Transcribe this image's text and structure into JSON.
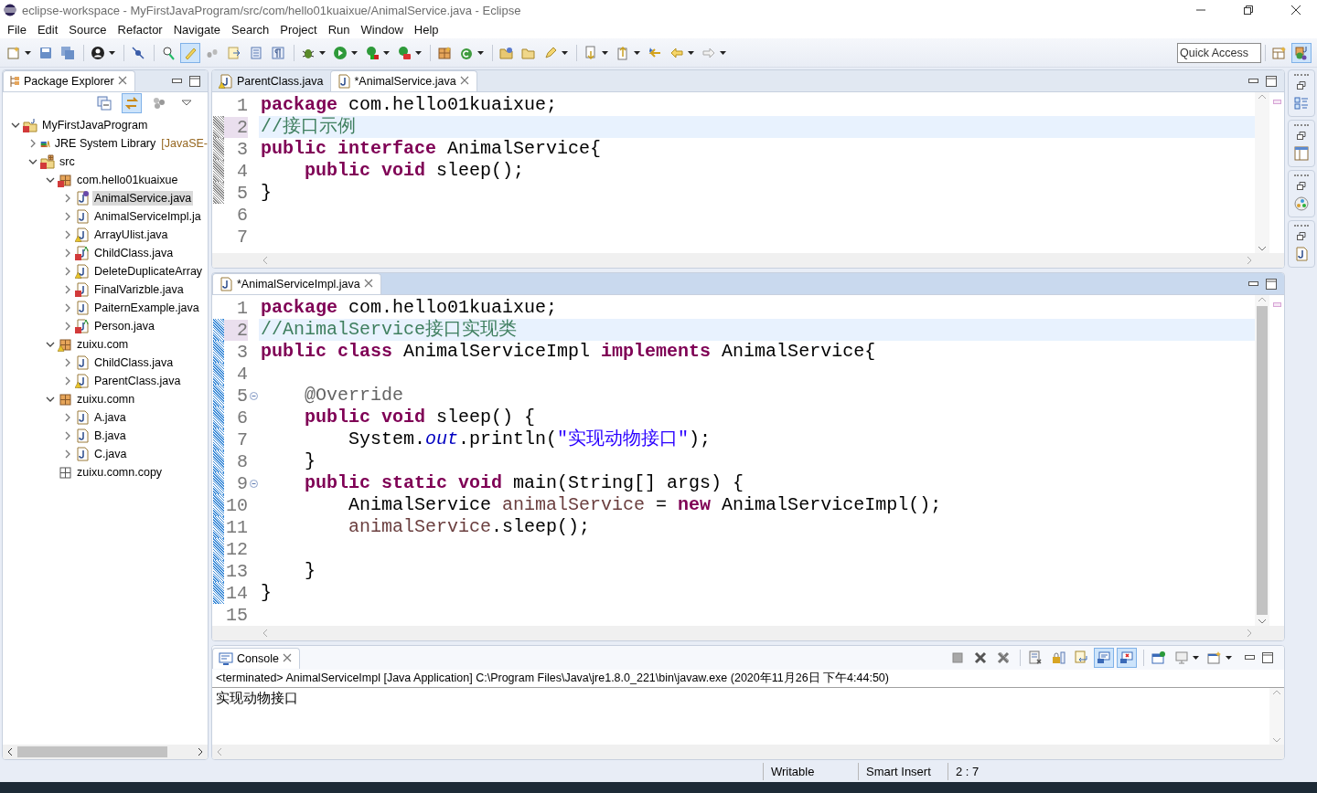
{
  "window": {
    "title": "eclipse-workspace - MyFirstJavaProgram/src/com/hello01kuaixue/AnimalService.java - Eclipse"
  },
  "menu": [
    "File",
    "Edit",
    "Source",
    "Refactor",
    "Navigate",
    "Search",
    "Project",
    "Run",
    "Window",
    "Help"
  ],
  "toolbar": [
    {
      "pressed": false
    },
    {
      "pressed": false
    },
    {
      "pressed": false
    },
    {
      "pressed": false
    },
    {
      "pressed": false
    },
    {
      "pressed": false
    },
    {
      "pressed": true
    },
    {
      "pressed": false
    },
    {
      "pressed": false
    },
    {
      "pressed": false
    },
    {
      "pressed": false
    },
    {
      "pressed": false
    },
    {
      "pressed": false
    },
    {
      "pressed": false
    },
    {
      "pressed": false
    },
    {
      "pressed": false
    },
    {
      "pressed": false
    },
    {
      "pressed": false
    },
    {
      "pressed": false
    },
    {
      "pressed": false
    },
    {
      "pressed": false
    },
    {
      "pressed": false
    },
    {
      "pressed": false
    },
    {
      "pressed": false
    },
    {
      "pressed": false
    }
  ],
  "quick_access": {
    "placeholder": "Quick Access"
  },
  "perspectives": [
    {
      "selected": false
    },
    {
      "selected": true
    }
  ],
  "package_explorer": {
    "title": "Package Explorer",
    "link_with_editor": true,
    "tree": [
      {
        "label": "MyFirstJavaProgram",
        "kind": "project",
        "error": true,
        "warning": false,
        "expanded": true,
        "selected": false,
        "children": [
          {
            "label": "JRE System Library",
            "suffix": "[JavaSE-",
            "kind": "library",
            "error": false,
            "warning": false,
            "expanded": false,
            "selected": false
          },
          {
            "label": "src",
            "kind": "folder",
            "error": true,
            "warning": false,
            "expanded": true,
            "selected": false,
            "children": [
              {
                "label": "com.hello01kuaixue",
                "kind": "package",
                "error": true,
                "warning": false,
                "expanded": true,
                "selected": false,
                "children": [
                  {
                    "label": "AnimalService.java",
                    "kind": "interface",
                    "error": false,
                    "warning": false,
                    "expanded": false,
                    "selected": true
                  },
                  {
                    "label": "AnimalServiceImpl.ja",
                    "kind": "class",
                    "error": false,
                    "warning": false,
                    "expanded": false,
                    "selected": false
                  },
                  {
                    "label": "ArrayUlist.java",
                    "kind": "class",
                    "error": false,
                    "warning": true,
                    "expanded": false,
                    "selected": false
                  },
                  {
                    "label": "ChildClass.java",
                    "kind": "abstract",
                    "error": true,
                    "warning": false,
                    "expanded": false,
                    "selected": false
                  },
                  {
                    "label": "DeleteDuplicateArray",
                    "kind": "class",
                    "error": false,
                    "warning": true,
                    "expanded": false,
                    "selected": false
                  },
                  {
                    "label": "FinalVarizble.java",
                    "kind": "class",
                    "error": true,
                    "warning": false,
                    "expanded": false,
                    "selected": false
                  },
                  {
                    "label": "PaiternExample.java",
                    "kind": "class",
                    "error": false,
                    "warning": false,
                    "expanded": false,
                    "selected": false
                  },
                  {
                    "label": "Person.java",
                    "kind": "abstract",
                    "error": true,
                    "warning": false,
                    "expanded": false,
                    "selected": false
                  }
                ]
              },
              {
                "label": "zuixu.com",
                "kind": "package",
                "error": false,
                "warning": true,
                "expanded": true,
                "selected": false,
                "children": [
                  {
                    "label": "ChildClass.java",
                    "kind": "class",
                    "error": false,
                    "warning": false,
                    "expanded": false,
                    "selected": false
                  },
                  {
                    "label": "ParentClass.java",
                    "kind": "class",
                    "error": false,
                    "warning": true,
                    "expanded": false,
                    "selected": false
                  }
                ]
              },
              {
                "label": "zuixu.comn",
                "kind": "package",
                "error": false,
                "warning": false,
                "expanded": true,
                "selected": false,
                "children": [
                  {
                    "label": "A.java",
                    "kind": "class",
                    "error": false,
                    "warning": false,
                    "expanded": false,
                    "selected": false
                  },
                  {
                    "label": "B.java",
                    "kind": "class",
                    "error": false,
                    "warning": false,
                    "expanded": false,
                    "selected": false
                  },
                  {
                    "label": "C.java",
                    "kind": "class",
                    "error": false,
                    "warning": false,
                    "expanded": false,
                    "selected": false
                  }
                ]
              },
              {
                "label": "zuixu.comn.copy",
                "kind": "empty",
                "error": false,
                "warning": false,
                "selected": false
              }
            ]
          }
        ]
      }
    ]
  },
  "editors": [
    {
      "active": false,
      "tabs": [
        {
          "label": "ParentClass.java",
          "warning": true,
          "selected": false
        },
        {
          "label": "*AnimalService.java",
          "warning": false,
          "selected": true
        }
      ],
      "lines": [
        {
          "number": "1",
          "changed": false,
          "current": false,
          "fold": false,
          "tokens": [
            {
              "kind": "kw",
              "text": "package"
            },
            {
              "kind": "text",
              "text": " com.hello01kuaixue;"
            }
          ]
        },
        {
          "number": "2",
          "changed": true,
          "current": true,
          "fold": false,
          "tokens": [
            {
              "kind": "comment",
              "text": "//接口示例"
            }
          ]
        },
        {
          "number": "3",
          "changed": true,
          "current": false,
          "fold": false,
          "tokens": [
            {
              "kind": "kw",
              "text": "public interface"
            },
            {
              "kind": "text",
              "text": " AnimalService{"
            }
          ]
        },
        {
          "number": "4",
          "changed": true,
          "current": false,
          "fold": false,
          "tokens": [
            {
              "kind": "kw",
              "text": "    public void"
            },
            {
              "kind": "text",
              "text": " sleep();"
            }
          ]
        },
        {
          "number": "5",
          "changed": true,
          "current": false,
          "fold": false,
          "tokens": [
            {
              "kind": "text",
              "text": "}"
            }
          ]
        },
        {
          "number": "6",
          "changed": false,
          "current": false,
          "fold": false
        },
        {
          "number": "7",
          "changed": false,
          "current": false,
          "fold": false
        }
      ]
    },
    {
      "active": true,
      "tabs": [
        {
          "label": "*AnimalServiceImpl.java",
          "warning": false,
          "selected": true
        }
      ],
      "lines": [
        {
          "number": "1",
          "changed": false,
          "current": false,
          "fold": false,
          "tokens": [
            {
              "kind": "kw",
              "text": "package"
            },
            {
              "kind": "text",
              "text": " com.hello01kuaixue;"
            }
          ]
        },
        {
          "number": "2",
          "changed": true,
          "current": true,
          "fold": false,
          "tokens": [
            {
              "kind": "comment",
              "text": "//AnimalService接口实现类"
            }
          ]
        },
        {
          "number": "3",
          "changed": true,
          "current": false,
          "fold": false,
          "tokens": [
            {
              "kind": "kw",
              "text": "public class"
            },
            {
              "kind": "text",
              "text": " AnimalServiceImpl "
            },
            {
              "kind": "kw",
              "text": "implements"
            },
            {
              "kind": "text",
              "text": " AnimalService{"
            }
          ]
        },
        {
          "number": "4",
          "changed": true,
          "current": false,
          "fold": false
        },
        {
          "number": "5",
          "changed": true,
          "current": false,
          "fold": true,
          "tokens": [
            {
              "kind": "annotation",
              "text": "    @Override"
            }
          ]
        },
        {
          "number": "6",
          "changed": true,
          "current": false,
          "fold": false,
          "tokens": [
            {
              "kind": "kw",
              "text": "    public void"
            },
            {
              "kind": "text",
              "text": " sleep() {"
            }
          ]
        },
        {
          "number": "7",
          "changed": true,
          "current": false,
          "fold": false,
          "tokens": [
            {
              "kind": "text",
              "text": "        System."
            },
            {
              "kind": "field",
              "text": "out"
            },
            {
              "kind": "text",
              "text": ".println("
            },
            {
              "kind": "string",
              "text": "\"实现动物接口\""
            },
            {
              "kind": "text",
              "text": ");"
            }
          ]
        },
        {
          "number": "8",
          "changed": true,
          "current": false,
          "fold": false,
          "tokens": [
            {
              "kind": "text",
              "text": "    }"
            }
          ]
        },
        {
          "number": "9",
          "changed": true,
          "current": false,
          "fold": true,
          "tokens": [
            {
              "kind": "kw",
              "text": "    public static void"
            },
            {
              "kind": "text",
              "text": " main(String[] args) {"
            }
          ]
        },
        {
          "number": "10",
          "changed": true,
          "current": false,
          "fold": false,
          "tokens": [
            {
              "kind": "text",
              "text": "        AnimalService "
            },
            {
              "kind": "local",
              "text": "animalService"
            },
            {
              "kind": "text",
              "text": " = "
            },
            {
              "kind": "kw",
              "text": "new"
            },
            {
              "kind": "text",
              "text": " AnimalServiceImpl();"
            }
          ]
        },
        {
          "number": "11",
          "changed": true,
          "current": false,
          "fold": false,
          "tokens": [
            {
              "kind": "local",
              "text": "        animalService"
            },
            {
              "kind": "text",
              "text": ".sleep();"
            }
          ]
        },
        {
          "number": "12",
          "changed": true,
          "current": false,
          "fold": false
        },
        {
          "number": "13",
          "changed": true,
          "current": false,
          "fold": false,
          "tokens": [
            {
              "kind": "text",
              "text": "    }"
            }
          ]
        },
        {
          "number": "14",
          "changed": true,
          "current": false,
          "fold": false,
          "tokens": [
            {
              "kind": "text",
              "text": "}"
            }
          ]
        },
        {
          "number": "15",
          "changed": false,
          "current": false,
          "fold": false
        }
      ]
    }
  ],
  "console": {
    "title": "Console",
    "toolbar": [
      {
        "pressed": false
      },
      {
        "pressed": false
      },
      {
        "pressed": false
      },
      {
        "pressed": false
      },
      {
        "pressed": false
      },
      {
        "pressed": false
      },
      {
        "pressed": true
      },
      {
        "pressed": true
      },
      {
        "pressed": false
      },
      {
        "pressed": false
      },
      {
        "pressed": false
      }
    ],
    "status": "<terminated> AnimalServiceImpl [Java Application] C:\\Program Files\\Java\\jre1.8.0_221\\bin\\javaw.exe (2020年11月26日 下午4:44:50)",
    "output": "实现动物接口"
  },
  "status_bar": [
    "Writable",
    "Smart Insert",
    "2 : 7"
  ]
}
